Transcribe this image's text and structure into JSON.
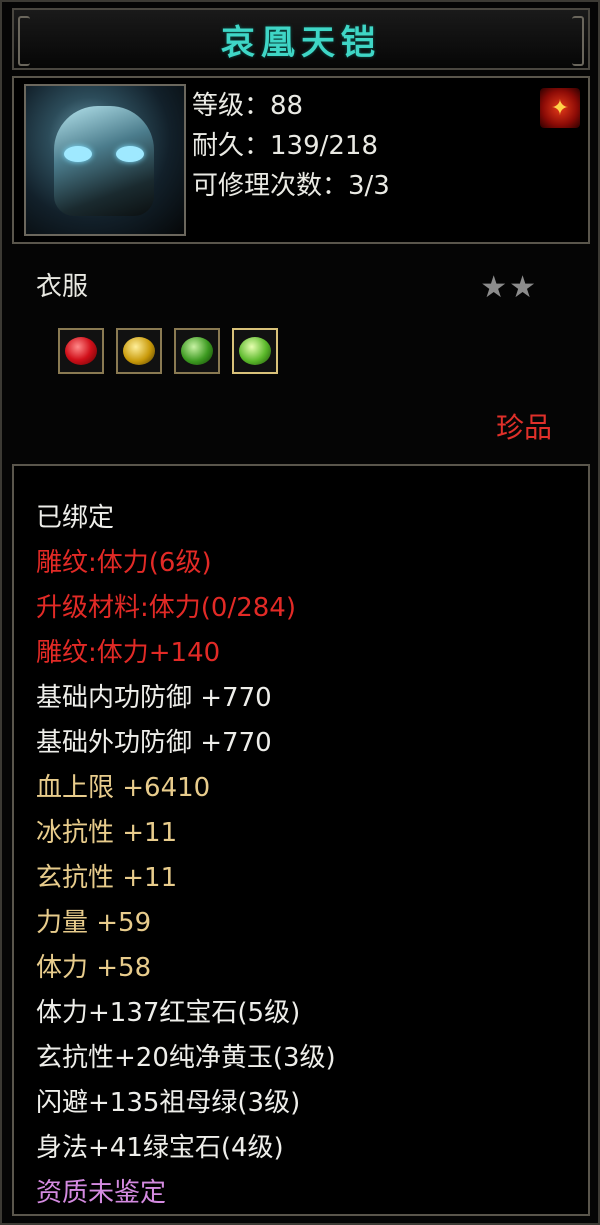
{
  "item": {
    "name": "哀凰天铠",
    "level_line": "等级：88",
    "durability_line": "耐久：139/218",
    "repair_line": "可修理次数：3/3",
    "type": "衣服",
    "stars": "★★",
    "rarity": "珍品"
  },
  "gems": [
    {
      "icon": "red-gem-icon"
    },
    {
      "icon": "yellow-jade-icon"
    },
    {
      "icon": "emerald-icon"
    },
    {
      "icon": "green-gem-icon"
    }
  ],
  "attributes": [
    {
      "text": "已绑定",
      "color": "white"
    },
    {
      "text": "雕纹:体力(6级)",
      "color": "red"
    },
    {
      "text": "升级材料:体力(0/284)",
      "color": "red"
    },
    {
      "text": "雕纹:体力+140",
      "color": "red"
    },
    {
      "text": "基础内功防御  +770",
      "color": "white"
    },
    {
      "text": "基础外功防御  +770",
      "color": "white"
    },
    {
      "text": "血上限  +6410",
      "color": "gold"
    },
    {
      "text": "冰抗性  +11",
      "color": "gold"
    },
    {
      "text": "玄抗性  +11",
      "color": "gold"
    },
    {
      "text": "力量  +59",
      "color": "gold"
    },
    {
      "text": "体力  +58",
      "color": "gold"
    },
    {
      "text": "体力+137红宝石(5级)",
      "color": "white"
    },
    {
      "text": "玄抗性+20纯净黄玉(3级)",
      "color": "white"
    },
    {
      "text": "闪避+135祖母绿(3级)",
      "color": "white"
    },
    {
      "text": "身法+41绿宝石(4级)",
      "color": "white"
    },
    {
      "text": "资质未鉴定",
      "color": "purple"
    }
  ],
  "colors": {
    "title": "#3fd6c6",
    "white": "#eeeeea",
    "red": "#e22a26",
    "gold": "#e8cc8c",
    "purple": "#d48ae0"
  }
}
